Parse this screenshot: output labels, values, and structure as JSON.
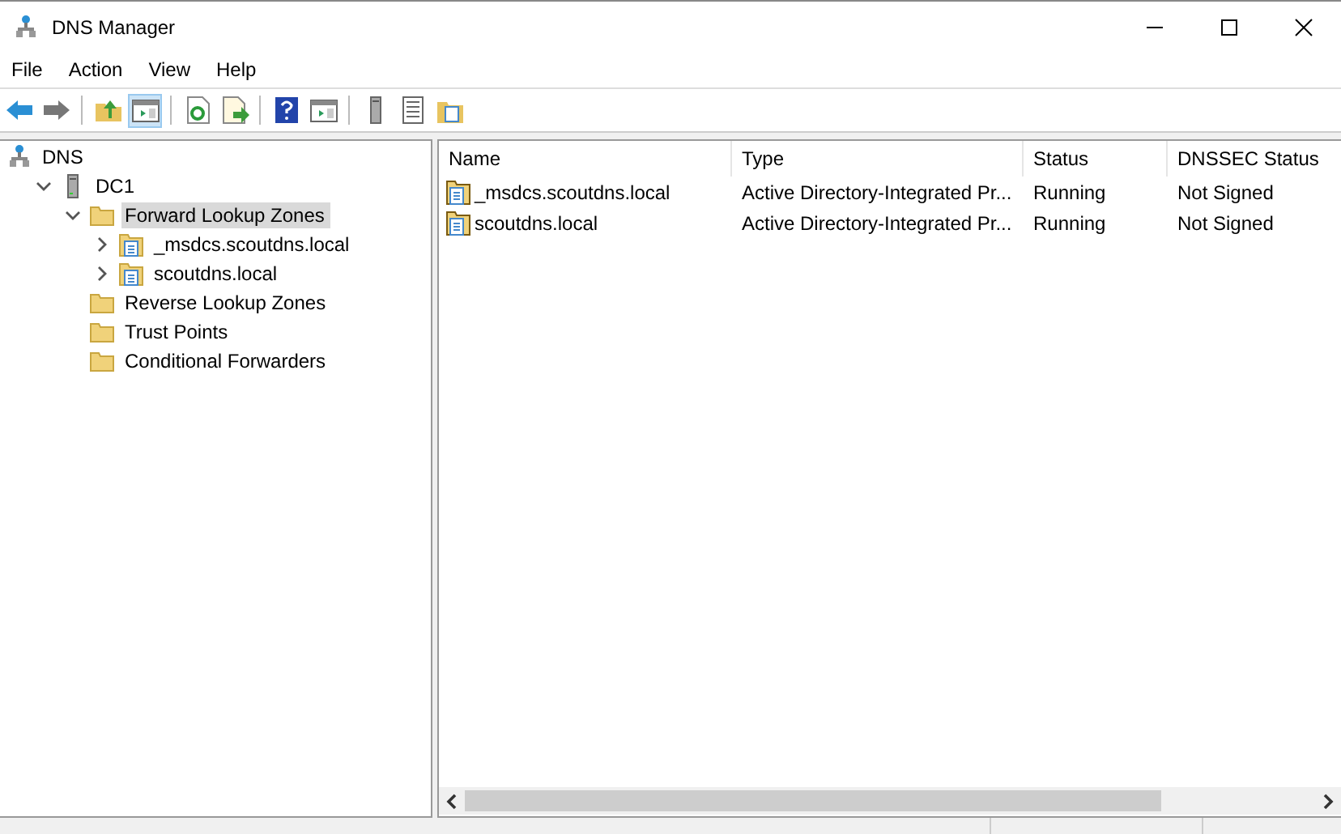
{
  "window": {
    "title": "DNS Manager"
  },
  "menu": [
    "File",
    "Action",
    "View",
    "Help"
  ],
  "toolbar": [
    {
      "kind": "back"
    },
    {
      "kind": "forward"
    },
    {
      "kind": "sep"
    },
    {
      "kind": "up"
    },
    {
      "kind": "pane",
      "selected": true
    },
    {
      "kind": "sep"
    },
    {
      "kind": "refresh"
    },
    {
      "kind": "export"
    },
    {
      "kind": "sep"
    },
    {
      "kind": "help"
    },
    {
      "kind": "pane",
      "selected": false
    },
    {
      "kind": "sep"
    },
    {
      "kind": "server"
    },
    {
      "kind": "list"
    },
    {
      "kind": "zone"
    }
  ],
  "tree": [
    {
      "label": "DNS",
      "kind": "dns",
      "selected": false,
      "children": [
        {
          "label": "DC1",
          "kind": "server",
          "expanded": true,
          "selected": false,
          "children": [
            {
              "label": "Forward Lookup Zones",
              "kind": "folder",
              "expanded": true,
              "selected": true,
              "children": [
                {
                  "label": "_msdcs.scoutdns.local",
                  "kind": "zone",
                  "expanded": false,
                  "selected": false
                },
                {
                  "label": "scoutdns.local",
                  "kind": "zone",
                  "expanded": false,
                  "selected": false
                }
              ]
            },
            {
              "label": "Reverse Lookup Zones",
              "kind": "folder",
              "selected": false
            },
            {
              "label": "Trust Points",
              "kind": "folder",
              "selected": false
            },
            {
              "label": "Conditional Forwarders",
              "kind": "folder",
              "selected": false
            }
          ]
        }
      ]
    }
  ],
  "table": {
    "columns": [
      "Name",
      "Type",
      "Status",
      "DNSSEC Status"
    ],
    "rows": [
      [
        "_msdcs.scoutdns.local",
        "Active Directory-Integrated Pr...",
        "Running",
        "Not Signed"
      ],
      [
        "scoutdns.local",
        "Active Directory-Integrated Pr...",
        "Running",
        "Not Signed"
      ]
    ]
  }
}
